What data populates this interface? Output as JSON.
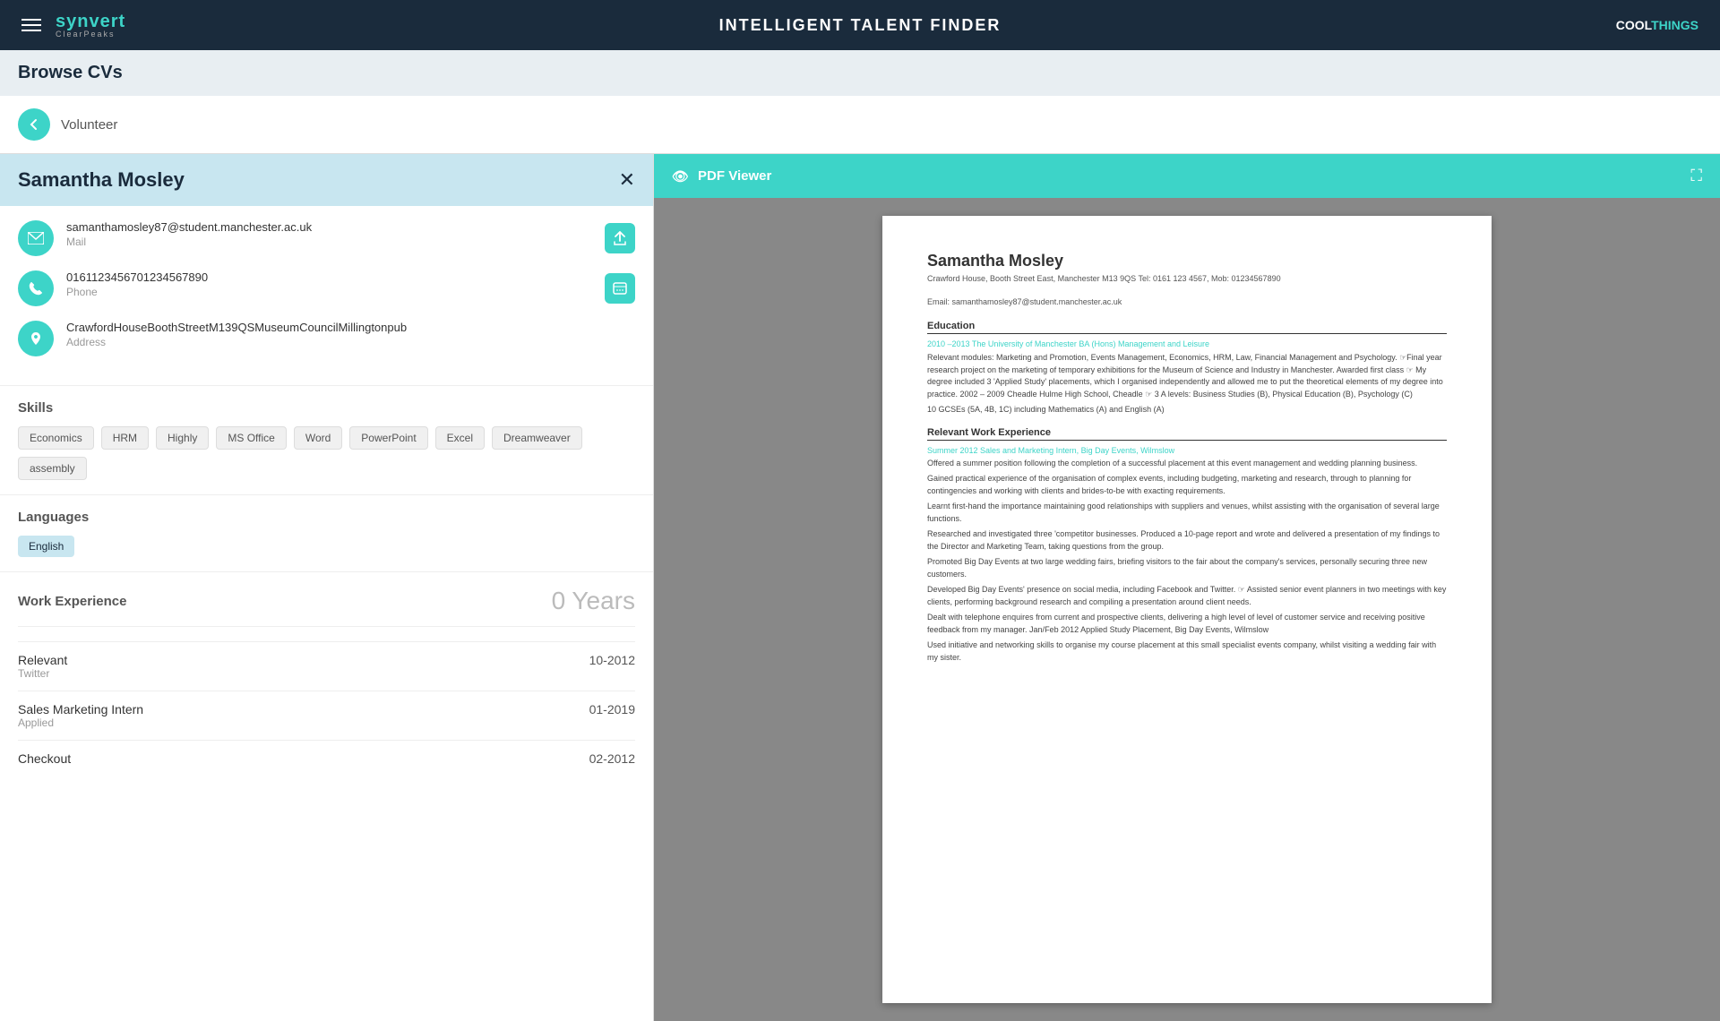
{
  "header": {
    "menu_icon": "hamburger-icon",
    "logo_main": "synvert",
    "logo_sub": "ClearPeaks",
    "title": "INTELLIGENT TALENT FINDER",
    "brand_cool": "COOL",
    "brand_things": "THINGS"
  },
  "page": {
    "title": "Browse CVs"
  },
  "search": {
    "placeholder": "Volunteer",
    "value": "Volunteer",
    "back_label": "←"
  },
  "candidate": {
    "name": "Samantha Mosley",
    "close_icon": "✕",
    "email": "samanthamosley87@student.manchester.ac.uk",
    "email_label": "Mail",
    "phone": "01611234567012345678​90",
    "phone_label": "Phone",
    "address": "CrawfordHouseBoothStreetM139QSMuseumCouncilMillingtonpub",
    "address_label": "Address",
    "skills_title": "Skills",
    "skills": [
      "Economics",
      "HRM",
      "Highly",
      "MS Office",
      "Word",
      "PowerPoint",
      "Excel",
      "Dreamweaver",
      "assembly"
    ],
    "languages_title": "Languages",
    "languages": [
      "English"
    ],
    "work_title": "Work Experience",
    "work_years": "0 Years",
    "work_items": [
      {
        "role": "Relevant",
        "type": "Twitter",
        "date": "10-2012"
      },
      {
        "role": "Sales Marketing Intern",
        "type": "Applied",
        "date": "01-2019"
      },
      {
        "role": "Checkout",
        "type": "",
        "date": "02-2012"
      }
    ]
  },
  "pdf_viewer": {
    "title": "PDF Viewer",
    "eye_icon": "👁",
    "expand_icon": "⛶",
    "cv": {
      "name": "Samantha Mosley",
      "address": "Crawford House, Booth Street East, Manchester M13 9QS Tel: 0161 123 4567, Mob: 01234567890",
      "email_line": "Email: samanthamosley87@student.manchester.ac.uk",
      "education_title": "Education",
      "edu_link": "2010 –2013 The University of Manchester BA (Hons) Management and Leisure",
      "edu_text1": "Relevant modules: Marketing and Promotion, Events Management, Economics, HRM, Law, Financial Management and Psychology. ☞Final year research project on the marketing of temporary exhibitions for the Museum of Science and Industry in Manchester. Awarded first class ☞ My degree included 3 'Applied Study' placements, which I organised independently and allowed me to put the theoretical elements of my degree into practice. 2002 – 2009 Cheadle Hulme High School, Cheadle ☞ 3 A levels: Business Studies (B), Physical Education (B), Psychology (C)",
      "edu_text2": "10 GCSEs (5A, 4B, 1C) including Mathematics (A) and English (A)",
      "work_title": "Relevant Work Experience",
      "work1_link": "Summer 2012 Sales and Marketing Intern, Big Day Events, Wilmslow",
      "work1_items": [
        "Offered a summer position following the completion of a successful placement at this event management and wedding planning business.",
        "Gained practical experience of the organisation of complex events, including budgeting, marketing and research, through to planning for contingencies and working with clients and brides-to-be with exacting requirements.",
        "Learnt first-hand the importance maintaining good relationships with suppliers and venues, whilst assisting with the organisation of several large functions.",
        "Researched and investigated three 'competitor businesses. Produced a 10-page report and wrote and delivered a presentation of my findings to the Director and Marketing Team, taking questions from the group.",
        "Promoted Big Day Events at two large wedding fairs, briefing visitors to the fair about the company's services, personally securing three new customers.",
        "Developed Big Day Events' presence on social media, including Facebook and Twitter. ☞ Assisted senior event planners in two meetings with key clients, performing background research and compiling a presentation around client needs.",
        "Dealt with telephone enquires from current and prospective clients, delivering a high level of level of customer service and receiving positive feedback from my manager. Jan/Feb 2012 Applied Study Placement, Big Day Events, Wilmslow",
        "Used initiative and networking skills to organise my course placement at this small specialist events company, whilst visiting a wedding fair with my sister."
      ]
    }
  }
}
